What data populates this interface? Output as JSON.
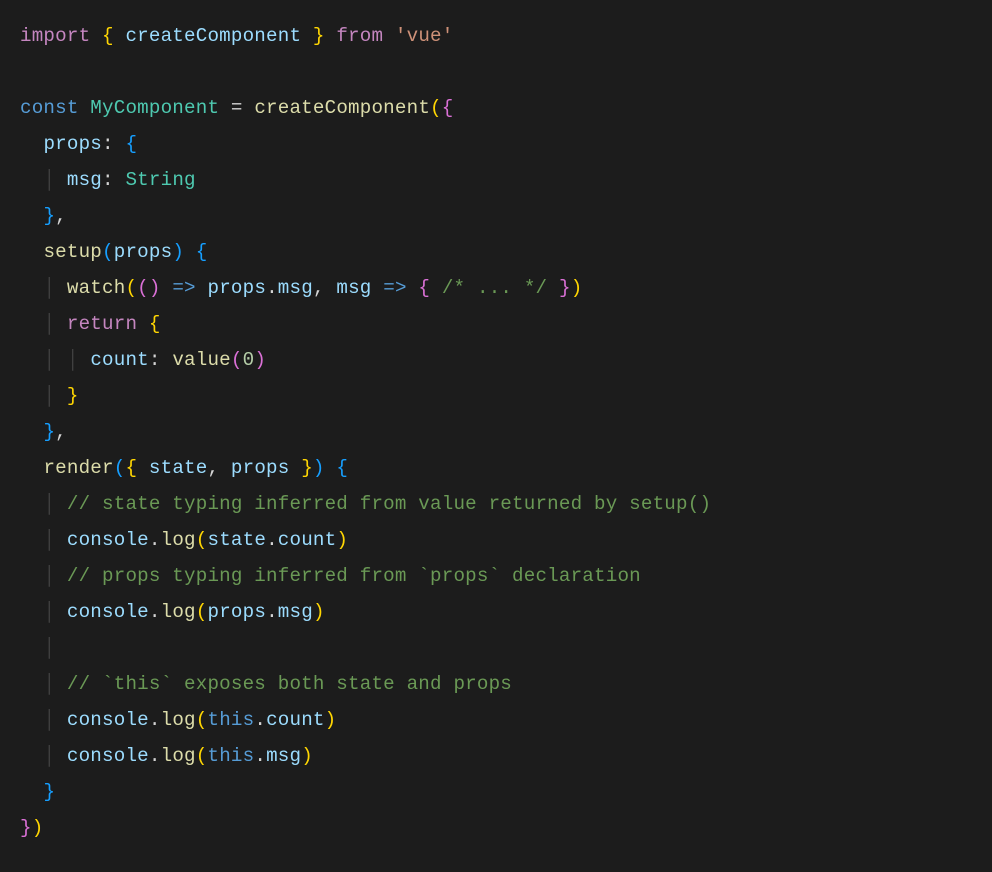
{
  "colors": {
    "background": "#1c1c1c",
    "default": "#d4d4d4",
    "keyword": "#c586c0",
    "function": "#dcdcaa",
    "identifier": "#9cdcfe",
    "class": "#4ec9b0",
    "string": "#ce9178",
    "number": "#b5cea8",
    "comment": "#6a9955",
    "bracket1": "#ffd602",
    "bracket2": "#da70d6",
    "bracket3": "#169fff",
    "blueKeyword": "#569cd6",
    "indentGuide": "#404040"
  },
  "tokens": {
    "kw_import": "import",
    "kw_from": "from",
    "kw_const": "const",
    "kw_return": "return",
    "fn_createComponent": "createComponent",
    "fn_setup": "setup",
    "fn_watch": "watch",
    "fn_render": "render",
    "fn_value": "value",
    "fn_log": "log",
    "id_MyComponent": "MyComponent",
    "id_props": "props",
    "id_msg": "msg",
    "id_count": "count",
    "id_state": "state",
    "id_console": "console",
    "cls_String": "String",
    "str_vue": "'vue'",
    "num_0": "0",
    "kw_this": "this",
    "cmt_ellipsis": "/* ... */",
    "cmt_state": "// state typing inferred from value returned by setup()",
    "cmt_props": "// props typing inferred from `props` declaration",
    "cmt_this": "// `this` exposes both state and props"
  },
  "code_plain": "import { createComponent } from 'vue'\n\nconst MyComponent = createComponent({\n  props: {\n    msg: String\n  },\n  setup(props) {\n    watch(() => props.msg, msg => { /* ... */ })\n    return {\n      count: value(0)\n    }\n  },\n  render({ state, props }) {\n    // state typing inferred from value returned by setup()\n    console.log(state.count)\n    // props typing inferred from `props` declaration\n    console.log(props.msg)\n\n    // `this` exposes both state and props\n    console.log(this.count)\n    console.log(this.msg)\n  }\n})"
}
